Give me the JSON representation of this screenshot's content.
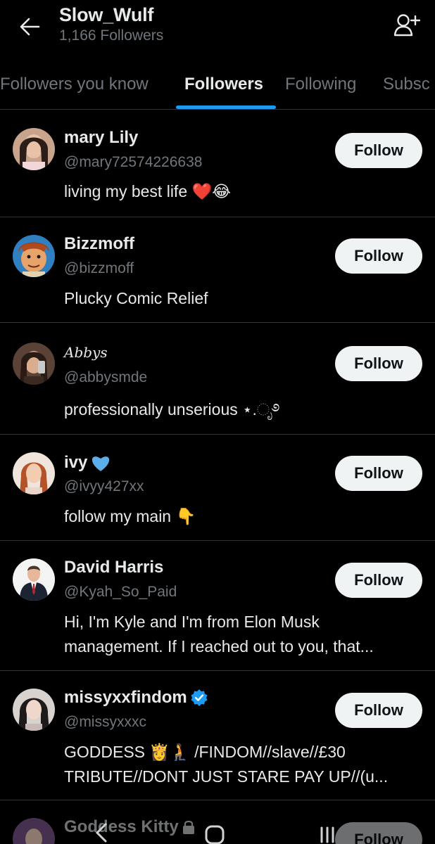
{
  "header": {
    "title": "Slow_Wulf",
    "subtitle": "1,166 Followers",
    "back_icon": "arrow-left-icon",
    "add_user_icon": "add-user-icon"
  },
  "tabs": [
    {
      "label": "Followers you know",
      "active": false
    },
    {
      "label": "Followers",
      "active": true
    },
    {
      "label": "Following",
      "active": false
    },
    {
      "label": "Subsc",
      "active": false
    }
  ],
  "colors": {
    "background": "#000000",
    "text_primary": "#e7e9ea",
    "text_secondary": "#71767b",
    "accent": "#1d9bf0",
    "follow_button_bg": "#eff3f4",
    "divider": "#2f3336"
  },
  "followers": [
    {
      "name": "mary Lily",
      "handle": "@mary72574226638",
      "bio": "living my best life ❤️😂",
      "button": "Follow"
    },
    {
      "name": "Bizzmoff",
      "handle": "@bizzmoff",
      "bio": "Plucky Comic Relief",
      "button": "Follow"
    },
    {
      "name": "Abbys",
      "handle": "@abbysmde",
      "bio": "professionally unserious ⋆.ೃ࿔",
      "button": "Follow"
    },
    {
      "name": "ivy",
      "handle": "@ivyy427xx",
      "bio": "follow my main 👇",
      "button": "Follow"
    },
    {
      "name": "David Harris",
      "handle": "@Kyah_So_Paid",
      "bio": "Hi, I'm Kyle and I'm from Elon Musk\nmanagement. If I reached out to you, that...",
      "button": "Follow"
    },
    {
      "name": "missyxxfindom",
      "handle": "@missyxxxc",
      "bio": "GODDESS 👸🧎 /FINDOM//slave//£30\nTRIBUTE//DONT JUST STARE PAY UP//(u...",
      "button": "Follow",
      "verified": true
    },
    {
      "name": "Goddess Kitty",
      "handle": "",
      "bio": "",
      "button": "Follow",
      "locked": true
    }
  ]
}
